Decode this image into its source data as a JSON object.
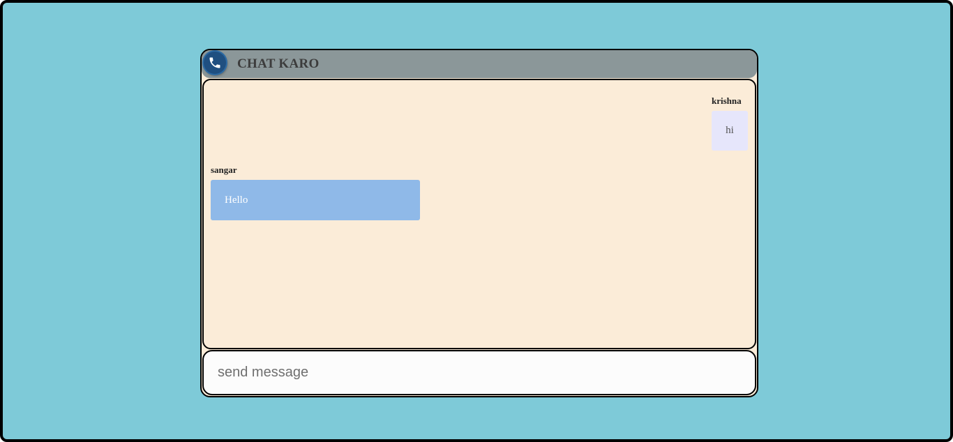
{
  "header": {
    "title": "CHAT KARO",
    "icon": "phone-icon"
  },
  "messages": [
    {
      "sender": "krishna",
      "text": "hi",
      "side": "right"
    },
    {
      "sender": "sangar",
      "text": "Hello",
      "side": "left"
    }
  ],
  "composer": {
    "placeholder": "send message",
    "value": ""
  },
  "colors": {
    "background": "#7ecad8",
    "header": "#8b9799",
    "chat_area": "#fbecd8",
    "bubble_right": "#e6e6fb",
    "bubble_left": "#8fb9e8",
    "phone_icon": "#1f4f80"
  }
}
